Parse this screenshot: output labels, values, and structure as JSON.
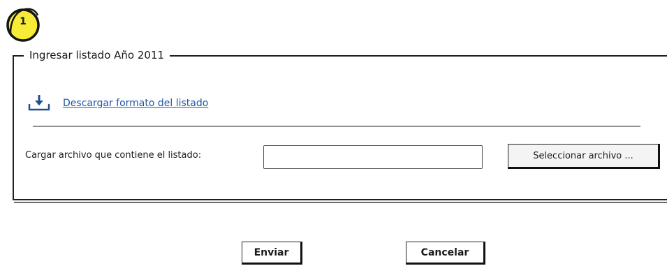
{
  "badge": {
    "number": "1"
  },
  "section": {
    "legend": "Ingresar listado Año 2011"
  },
  "download": {
    "icon": "download-icon",
    "link_text": "Descargar formato del listado"
  },
  "upload": {
    "label": "Cargar archivo que contiene el listado:",
    "input_value": "",
    "select_button": "Seleccionar archivo ..."
  },
  "actions": {
    "send": "Enviar",
    "cancel": "Cancelar"
  },
  "colors": {
    "badge_fill": "#f8ec37",
    "link": "#1f55a6",
    "icon": "#1f4f8f",
    "border": "#1f1f1f"
  }
}
